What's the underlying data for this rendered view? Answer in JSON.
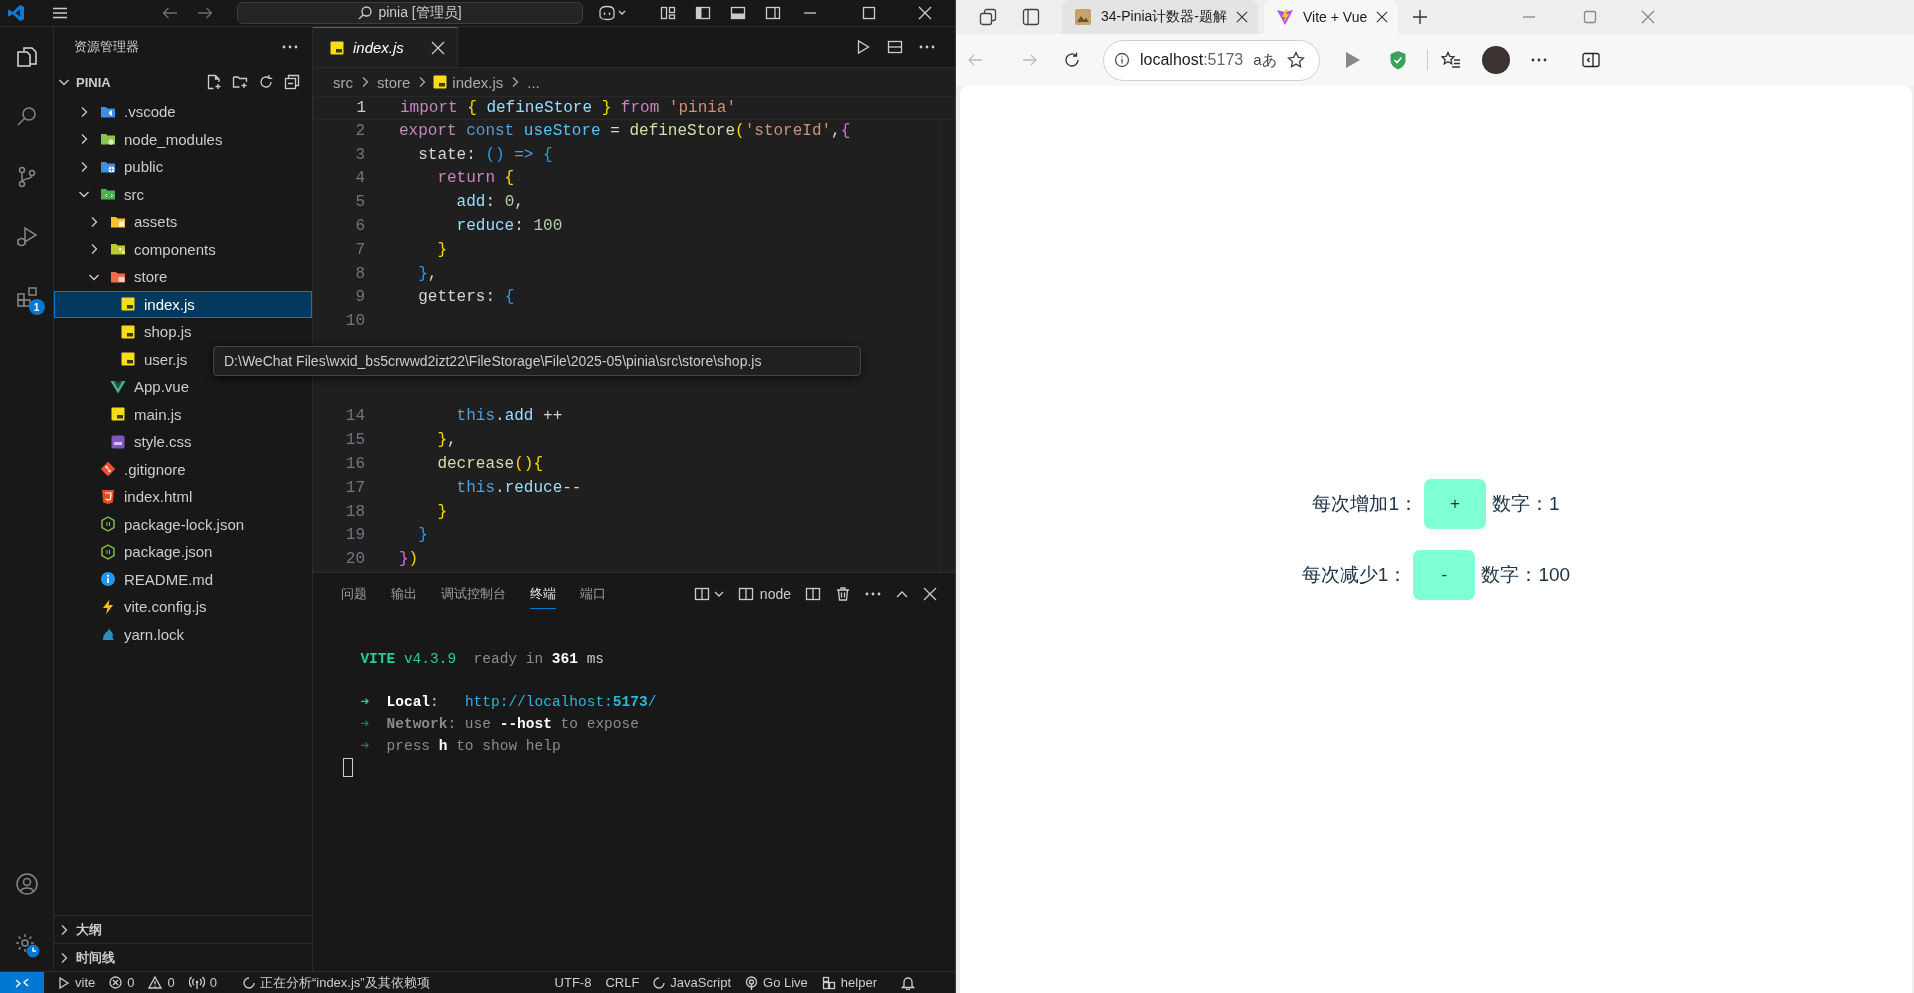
{
  "vscode": {
    "title_bar": {
      "command_center": "pinia [管理员]"
    },
    "activity_bar": {
      "extensions_badge": "1"
    },
    "explorer": {
      "title": "资源管理器",
      "root": "PINIA",
      "root_expanded": true,
      "tree": [
        {
          "label": ".vscode",
          "kind": "vscode-folder",
          "expanded": false,
          "selected": false
        },
        {
          "label": "node_modules",
          "kind": "node-folder",
          "expanded": false,
          "selected": false
        },
        {
          "label": "public",
          "kind": "public-folder",
          "expanded": false,
          "selected": false
        },
        {
          "label": "src",
          "kind": "src-folder",
          "expanded": true,
          "selected": false,
          "children": [
            {
              "label": "assets",
              "kind": "assets-folder",
              "expanded": false,
              "selected": false
            },
            {
              "label": "components",
              "kind": "components-folder",
              "expanded": false,
              "selected": false
            },
            {
              "label": "store",
              "kind": "store-folder",
              "expanded": true,
              "selected": false,
              "children": [
                {
                  "label": "index.js",
                  "kind": "js",
                  "selected": true
                },
                {
                  "label": "shop.js",
                  "kind": "js",
                  "selected": false
                },
                {
                  "label": "user.js",
                  "kind": "js",
                  "selected": false
                }
              ]
            },
            {
              "label": "App.vue",
              "kind": "vue",
              "selected": false
            },
            {
              "label": "main.js",
              "kind": "js",
              "selected": false
            },
            {
              "label": "style.css",
              "kind": "css",
              "selected": false
            }
          ]
        },
        {
          "label": ".gitignore",
          "kind": "git",
          "selected": false
        },
        {
          "label": "index.html",
          "kind": "html",
          "selected": false
        },
        {
          "label": "package-lock.json",
          "kind": "json",
          "selected": false
        },
        {
          "label": "package.json",
          "kind": "json",
          "selected": false
        },
        {
          "label": "README.md",
          "kind": "info",
          "selected": false
        },
        {
          "label": "vite.config.js",
          "kind": "vite",
          "selected": false
        },
        {
          "label": "yarn.lock",
          "kind": "yarn",
          "selected": false
        }
      ],
      "sections": [
        {
          "label": "大纲",
          "expanded": false
        },
        {
          "label": "时间线",
          "expanded": false
        }
      ]
    },
    "editor": {
      "tabs": [
        {
          "label": "index.js",
          "selected": true,
          "preview": true
        }
      ],
      "breadcrumbs": [
        "src",
        "store",
        "index.js",
        "..."
      ],
      "code_blocks": [
        [
          {
            "number": "1",
            "current": true,
            "tokens": [
              {
                "kind": "kw",
                "text": "import"
              },
              {
                "kind": "b1",
                "text": " {"
              },
              {
                "kind": "var",
                "text": " defineStore"
              },
              {
                "kind": "b1",
                "text": " }"
              },
              {
                "kind": "kw",
                "text": " from"
              },
              {
                "kind": "str",
                "text": " 'pinia'"
              }
            ]
          },
          {
            "number": "2",
            "current": false,
            "tokens": [
              {
                "kind": "kw",
                "text": "export"
              },
              {
                "kind": "decl",
                "text": " const"
              },
              {
                "kind": "const",
                "text": " useStore"
              },
              {
                "kind": "plain",
                "text": " = "
              },
              {
                "kind": "fn",
                "text": "defineStore"
              },
              {
                "kind": "b1",
                "text": "("
              },
              {
                "kind": "str",
                "text": "'storeId'"
              },
              {
                "kind": "plain",
                "text": ","
              },
              {
                "kind": "b2",
                "text": "{"
              }
            ]
          },
          {
            "number": "3",
            "current": false,
            "tokens": [
              {
                "kind": "plain",
                "text": "  state: "
              },
              {
                "kind": "b3",
                "text": "()"
              },
              {
                "kind": "decl",
                "text": " =>"
              },
              {
                "kind": "b3",
                "text": " {"
              }
            ]
          },
          {
            "number": "4",
            "current": false,
            "tokens": [
              {
                "kind": "kw",
                "text": "    return"
              },
              {
                "kind": "b1",
                "text": " {"
              }
            ]
          },
          {
            "number": "5",
            "current": false,
            "tokens": [
              {
                "kind": "prop",
                "text": "      add"
              },
              {
                "kind": "plain",
                "text": ": "
              },
              {
                "kind": "num",
                "text": "0"
              },
              {
                "kind": "plain",
                "text": ","
              }
            ]
          },
          {
            "number": "6",
            "current": false,
            "tokens": [
              {
                "kind": "prop",
                "text": "      reduce"
              },
              {
                "kind": "plain",
                "text": ": "
              },
              {
                "kind": "num",
                "text": "100"
              }
            ]
          },
          {
            "number": "7",
            "current": false,
            "tokens": [
              {
                "kind": "b1",
                "text": "    }"
              }
            ]
          },
          {
            "number": "8",
            "current": false,
            "tokens": [
              {
                "kind": "b3",
                "text": "  }"
              },
              {
                "kind": "plain",
                "text": ","
              }
            ]
          },
          {
            "number": "9",
            "current": false,
            "tokens": [
              {
                "kind": "plain",
                "text": "  getters: "
              },
              {
                "kind": "b3",
                "text": "{"
              }
            ]
          },
          {
            "number": "10",
            "current": false
          }
        ],
        [
          {
            "number": "14",
            "current": false,
            "tokens": [
              {
                "kind": "decl",
                "text": "      this"
              },
              {
                "kind": "plain",
                "text": "."
              },
              {
                "kind": "prop",
                "text": "add"
              },
              {
                "kind": "plain",
                "text": " ++"
              }
            ]
          },
          {
            "number": "15",
            "current": false,
            "tokens": [
              {
                "kind": "b1",
                "text": "    }"
              },
              {
                "kind": "plain",
                "text": ","
              }
            ]
          },
          {
            "number": "16",
            "current": false,
            "tokens": [
              {
                "kind": "fn",
                "text": "    decrease"
              },
              {
                "kind": "b1",
                "text": "(){"
              }
            ]
          },
          {
            "number": "17",
            "current": false,
            "tokens": [
              {
                "kind": "decl",
                "text": "      this"
              },
              {
                "kind": "plain",
                "text": "."
              },
              {
                "kind": "prop",
                "text": "reduce"
              },
              {
                "kind": "plain",
                "text": "--"
              }
            ]
          },
          {
            "number": "18",
            "current": false,
            "tokens": [
              {
                "kind": "b1",
                "text": "    }"
              }
            ]
          },
          {
            "number": "19",
            "current": false,
            "tokens": [
              {
                "kind": "b3",
                "text": "  }"
              }
            ]
          },
          {
            "number": "20",
            "current": false,
            "tokens": [
              {
                "kind": "b2",
                "text": "}"
              },
              {
                "kind": "b1",
                "text": ")"
              }
            ]
          }
        ]
      ],
      "tooltip": "D:\\WeChat Files\\wxid_bs5crwwd2izt22\\FileStorage\\File\\2025-05\\pinia\\src\\store\\shop.js"
    },
    "panel": {
      "tabs": [
        {
          "label": "问题",
          "selected": false
        },
        {
          "label": "输出",
          "selected": false
        },
        {
          "label": "调试控制台",
          "selected": false
        },
        {
          "label": "终端",
          "selected": true
        },
        {
          "label": "端口",
          "selected": false
        }
      ],
      "terminal_name": "node",
      "terminal_blocks": [
        [
          [
            {
              "kind": "brand",
              "text": "  VITE"
            },
            {
              "kind": "green",
              "text": " v4.3.9"
            },
            {
              "kind": "dim",
              "text": "  ready in "
            },
            {
              "kind": "bold",
              "text": "361"
            },
            {
              "kind": "plain",
              "text": " ms"
            }
          ]
        ],
        [
          [
            {
              "kind": "arrow",
              "text": "  ➜"
            },
            {
              "kind": "bold",
              "text": "  Local"
            },
            {
              "kind": "plain",
              "text": ":   "
            },
            {
              "kind": "link",
              "text": "http://localhost:"
            },
            {
              "kind": "linkbold",
              "text": "5173"
            },
            {
              "kind": "link",
              "text": "/"
            }
          ],
          [
            {
              "kind": "arrowdim",
              "text": "  ➜"
            },
            {
              "kind": "dimbold",
              "text": "  Network"
            },
            {
              "kind": "dim",
              "text": ": use "
            },
            {
              "kind": "bold",
              "text": "--host"
            },
            {
              "kind": "dim",
              "text": " to expose"
            }
          ],
          [
            {
              "kind": "arrowdim",
              "text": "  ➜"
            },
            {
              "kind": "dim",
              "text": "  press "
            },
            {
              "kind": "bold",
              "text": "h"
            },
            {
              "kind": "dim",
              "text": " to show help"
            }
          ]
        ]
      ]
    },
    "status_bar": {
      "items": [
        {
          "kind": "run",
          "text": "vite"
        },
        {
          "kind": "errors",
          "text": "0"
        },
        {
          "kind": "warnings",
          "text": "0"
        },
        {
          "kind": "ports",
          "text": "0"
        },
        {
          "kind": "progress",
          "text": "正在分析“index.js”及其依赖项"
        },
        {
          "kind": "plain",
          "text": "UTF-8"
        },
        {
          "kind": "plain",
          "text": "CRLF"
        },
        {
          "kind": "language",
          "text": "JavaScript"
        },
        {
          "kind": "golive",
          "text": "Go Live"
        },
        {
          "kind": "helper",
          "text": "helper"
        }
      ]
    }
  },
  "browser": {
    "tabs": [
      {
        "title": "34-Pinia计数器-题解",
        "kind": "picture",
        "selected": false
      },
      {
        "title": "Vite + Vue",
        "kind": "bolt",
        "selected": true
      }
    ],
    "address": {
      "host": "localhost",
      "port": ":5173"
    },
    "read_aloud": "aあ",
    "page": {
      "rows": [
        {
          "label": "每次增加1：",
          "button": "+",
          "result": "数字：1"
        },
        {
          "label": "每次减少1：",
          "button": "-",
          "result": "数字：100"
        }
      ]
    }
  }
}
